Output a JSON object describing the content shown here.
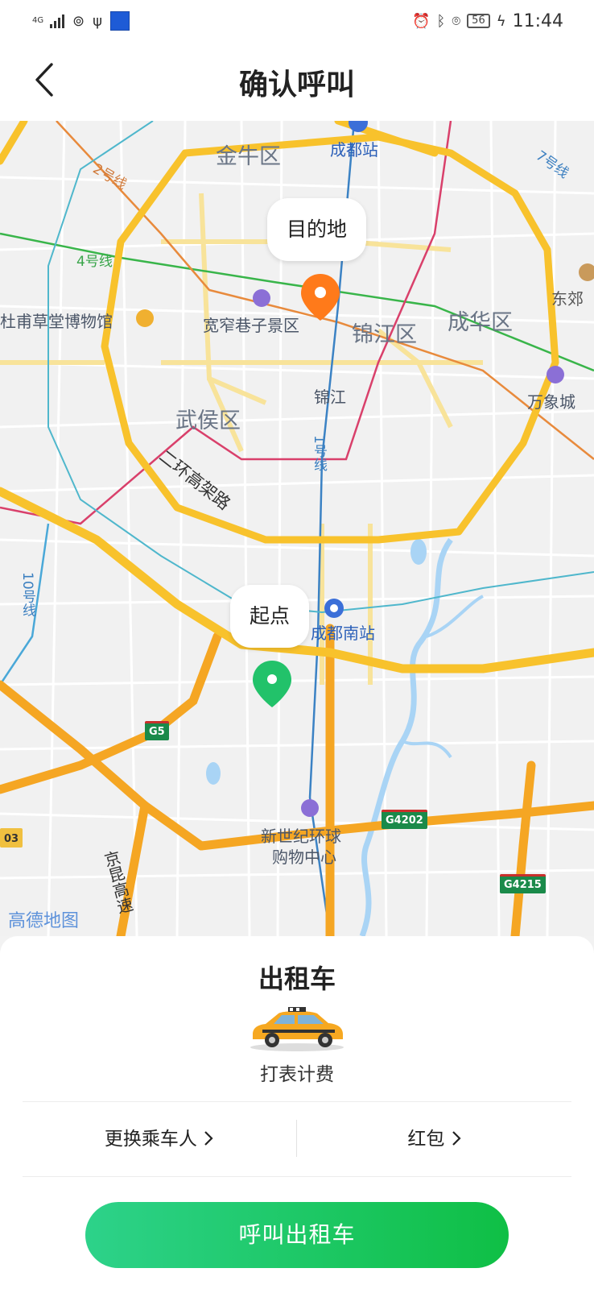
{
  "status_bar": {
    "network_type": "4G",
    "battery": "56",
    "time": "11:44"
  },
  "header": {
    "title": "确认呼叫"
  },
  "map": {
    "bubbles": {
      "destination": "目的地",
      "origin": "起点"
    },
    "labels": {
      "jinniu": "金牛区",
      "chengdu_station": "成都站",
      "line7": "7号线",
      "line2": "2号线",
      "line4": "4号线",
      "dongjiao": "东郊",
      "dufu": "杜甫草堂博物馆",
      "kuanzhai": "宽窄巷子景区",
      "jinjiang_district": "锦江区",
      "chenghua": "成华区",
      "wanxiang": "万象城",
      "jinjiang": "锦江",
      "wuhou": "武侯区",
      "line1": "1号线",
      "second_ring": "二环高架路",
      "line10": "10号线",
      "south_station": "成都南站",
      "new_century_1": "新世纪环球",
      "new_century_2": "购物中心",
      "jingkun": "京昆高速",
      "amap": "高德地图",
      "edge_code": "03"
    },
    "shields": {
      "g5": "G5",
      "g4202": "G4202",
      "g4215": "G4215"
    }
  },
  "sheet": {
    "car_type": "出租车",
    "fare_mode": "打表计费",
    "change_passenger": "更换乘车人",
    "red_packet": "红包",
    "call_button": "呼叫出租车"
  },
  "colors": {
    "accent_green": "#16c15a",
    "destination_pin": "#ff7a1a",
    "origin_pin": "#22c26a",
    "ring_road": "#f8c22c"
  }
}
